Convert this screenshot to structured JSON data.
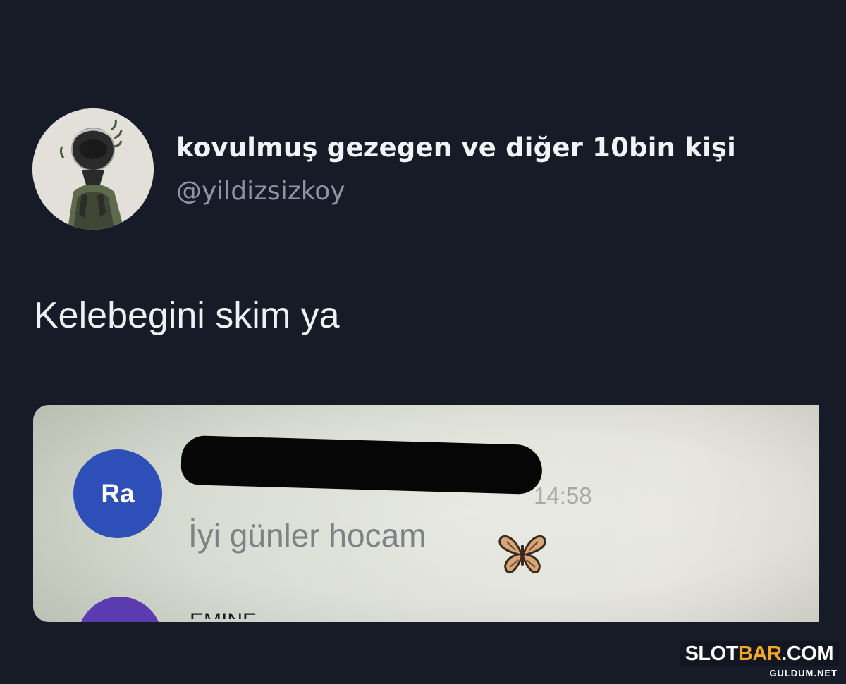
{
  "tweet": {
    "author": {
      "display_name": "kovulmuş gezegen ve diğer 10bin kişi",
      "handle": "@yildizsizkoy"
    },
    "text": "Kelebegini skim ya",
    "attached_image": {
      "sender_initials": "Ra",
      "time": "14:58",
      "message": "İyi günler hocam",
      "emoji_icon": "butterfly-icon",
      "next_sender_partial": "EMİNE"
    }
  },
  "watermark": {
    "brand_part1": "SLOT",
    "brand_part2": "BAR",
    "brand_part3": ".COM",
    "subtext": "GULDUM.NET",
    "accent_color": "#f5a623"
  },
  "colors": {
    "background": "#161b27",
    "handle": "#8b95a4",
    "sender_avatar": "#2f4fb8"
  }
}
